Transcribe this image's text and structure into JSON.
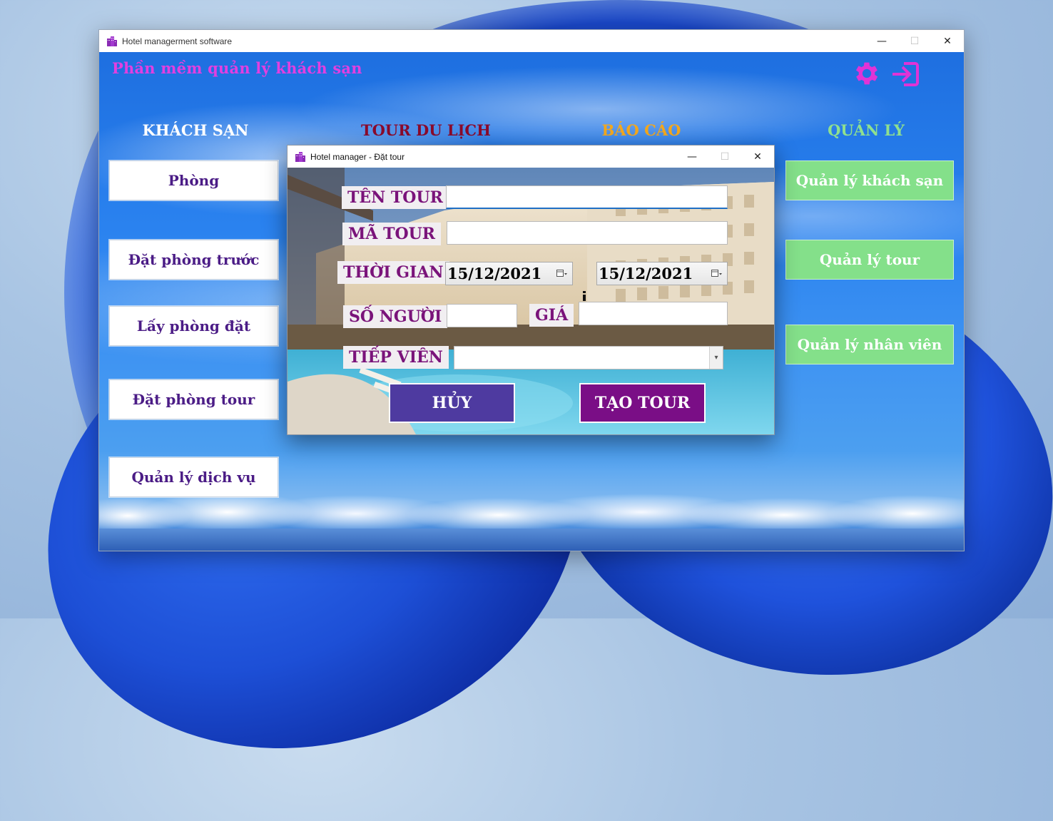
{
  "main_window": {
    "title": "Hotel managerment software",
    "heading": "Phần mềm quản lý khách sạn",
    "sections": {
      "hotel": "KHÁCH SẠN",
      "tour": "TOUR DU LỊCH",
      "report": "BÁO CÁO",
      "manage": "QUẢN LÝ"
    },
    "left_buttons": [
      "Phòng",
      "Đặt phòng trước",
      "Lấy phòng đặt",
      "Đặt phòng tour",
      "Quản lý dịch vụ"
    ],
    "right_buttons": [
      "Quản lý khách sạn",
      "Quản lý tour",
      "Quản lý nhân viên"
    ],
    "icons": [
      "gear-icon",
      "exit-icon"
    ],
    "colors": {
      "heading": "#e23fe0",
      "gear": "#e033d6",
      "manage_button": "#84e08a"
    }
  },
  "dialog": {
    "title": "Hotel manager - Đặt tour",
    "labels": {
      "tour_name": "TÊN TOUR",
      "tour_code": "MÃ TOUR",
      "time": "THỜI GIAN",
      "people": "SỐ NGƯỜI",
      "price": "GIÁ",
      "guide": "TIẾP VIÊN"
    },
    "values": {
      "tour_name": "",
      "tour_code": "",
      "start_date": "15/12/2021",
      "end_date": "15/12/2021",
      "people": "",
      "price": "",
      "guide": ""
    },
    "buttons": {
      "cancel": "HỦY",
      "create": "TẠO TOUR"
    },
    "colors": {
      "cancel": "#4e3aa0",
      "create": "#7a0e86",
      "label_text": "#7a137a"
    }
  }
}
